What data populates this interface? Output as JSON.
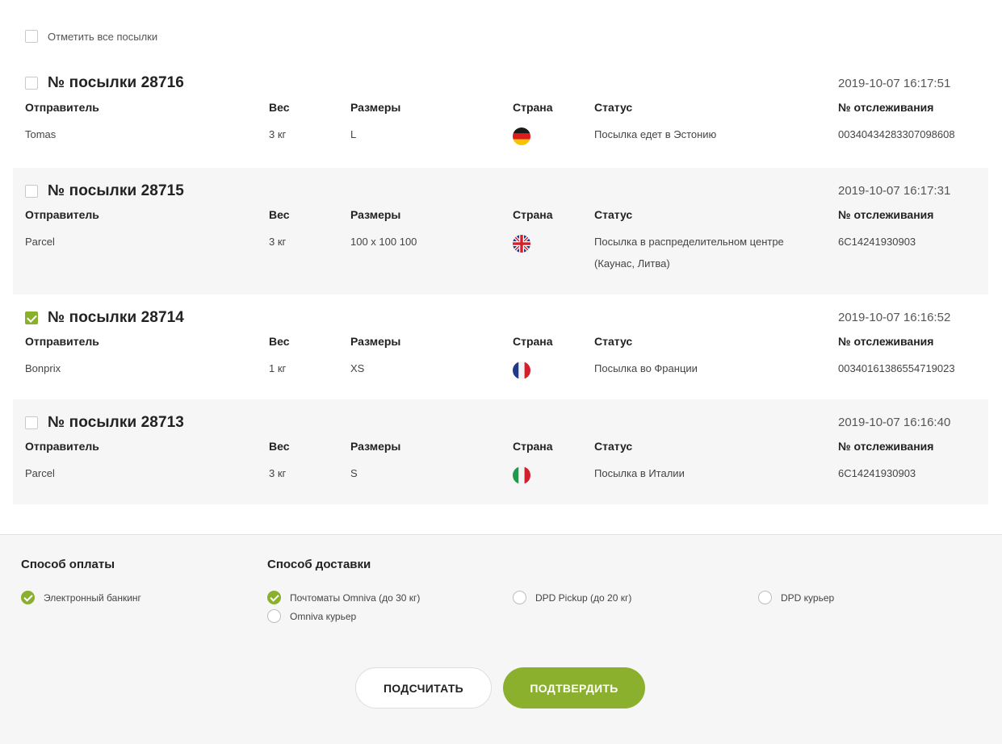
{
  "select_all": {
    "label": "Отметить все посылки",
    "checked": false
  },
  "columns": {
    "sender": "Отправитель",
    "weight": "Вес",
    "size": "Размеры",
    "country": "Страна",
    "status": "Статус",
    "tracking": "№ отслеживания"
  },
  "parcels": [
    {
      "title": "№ посылки 28716",
      "date": "2019-10-07 16:17:51",
      "sender": "Tomas",
      "weight": "3 кг",
      "size": "L",
      "country_flag": "germany-flag",
      "status": "Посылка едет в Эстонию",
      "tracking": "00340434283307098608",
      "checked": false
    },
    {
      "title": "№ посылки 28715",
      "date": "2019-10-07 16:17:31",
      "sender": "Parcel",
      "weight": "3 кг",
      "size": "100 x 100 100",
      "country_flag": "uk-flag",
      "status": "Посылка в распределительном центре (Каунас, Литва)",
      "tracking": "6C14241930903",
      "checked": false
    },
    {
      "title": "№ посылки 28714",
      "date": "2019-10-07 16:16:52",
      "sender": "Bonprix",
      "weight": "1 кг",
      "size": "XS",
      "country_flag": "france-flag",
      "status": "Посылка во Франции",
      "tracking": "00340161386554719023",
      "checked": true
    },
    {
      "title": "№ посылки 28713",
      "date": "2019-10-07 16:16:40",
      "sender": "Parcel",
      "weight": "3 кг",
      "size": "S",
      "country_flag": "italy-flag",
      "status": "Посылка в Италии",
      "tracking": "6C14241930903",
      "checked": false
    }
  ],
  "payment": {
    "heading": "Способ оплаты",
    "options": [
      {
        "label": "Электронный банкинг",
        "selected": true
      }
    ]
  },
  "delivery": {
    "heading": "Способ доставки",
    "options": [
      {
        "label": "Почтоматы Omniva (до 30 кг)",
        "selected": true
      },
      {
        "label": "DPD Pickup (до 20 кг)",
        "selected": false
      },
      {
        "label": "DPD курьер",
        "selected": false
      },
      {
        "label": "Omniva курьер",
        "selected": false
      }
    ]
  },
  "buttons": {
    "calculate": "ПОДСЧИТАТЬ",
    "confirm": "ПОДТВЕРДИТЬ"
  },
  "colors": {
    "accent": "#8ab02d",
    "alt_row": "#f6f6f6"
  }
}
